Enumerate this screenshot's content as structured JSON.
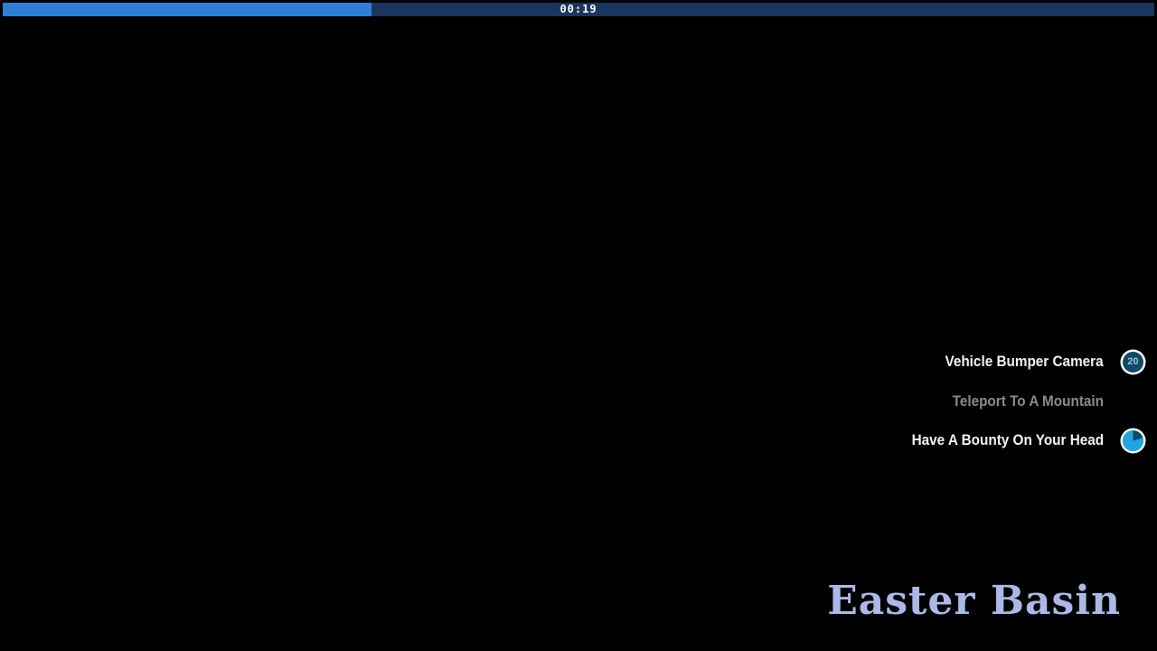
{
  "timer": {
    "text": "00:19",
    "progress": 0.32
  },
  "effects": [
    {
      "label": "Vehicle Bumper Camera",
      "active": true,
      "indicator": "countdown-circle",
      "count": "20",
      "fill": 0
    },
    {
      "label": "Teleport To A Mountain",
      "active": false,
      "indicator": "none",
      "count": "",
      "fill": 0
    },
    {
      "label": "Have A Bounty On Your Head",
      "active": true,
      "indicator": "timer-pie",
      "count": "",
      "fill": 0.8
    }
  ],
  "area": {
    "name": "Easter Basin"
  },
  "colors": {
    "background": "#000000",
    "timer_track": "#1b365e",
    "timer_fill": "#2f7fd9",
    "effect_active": "#f2f2f2",
    "effect_inactive": "#8a8a8a",
    "indicator_ring": "#ffffff",
    "indicator_fill": "#1ea7e1",
    "indicator_dark": "#0f4a66",
    "area_name": "#aab9e8"
  }
}
